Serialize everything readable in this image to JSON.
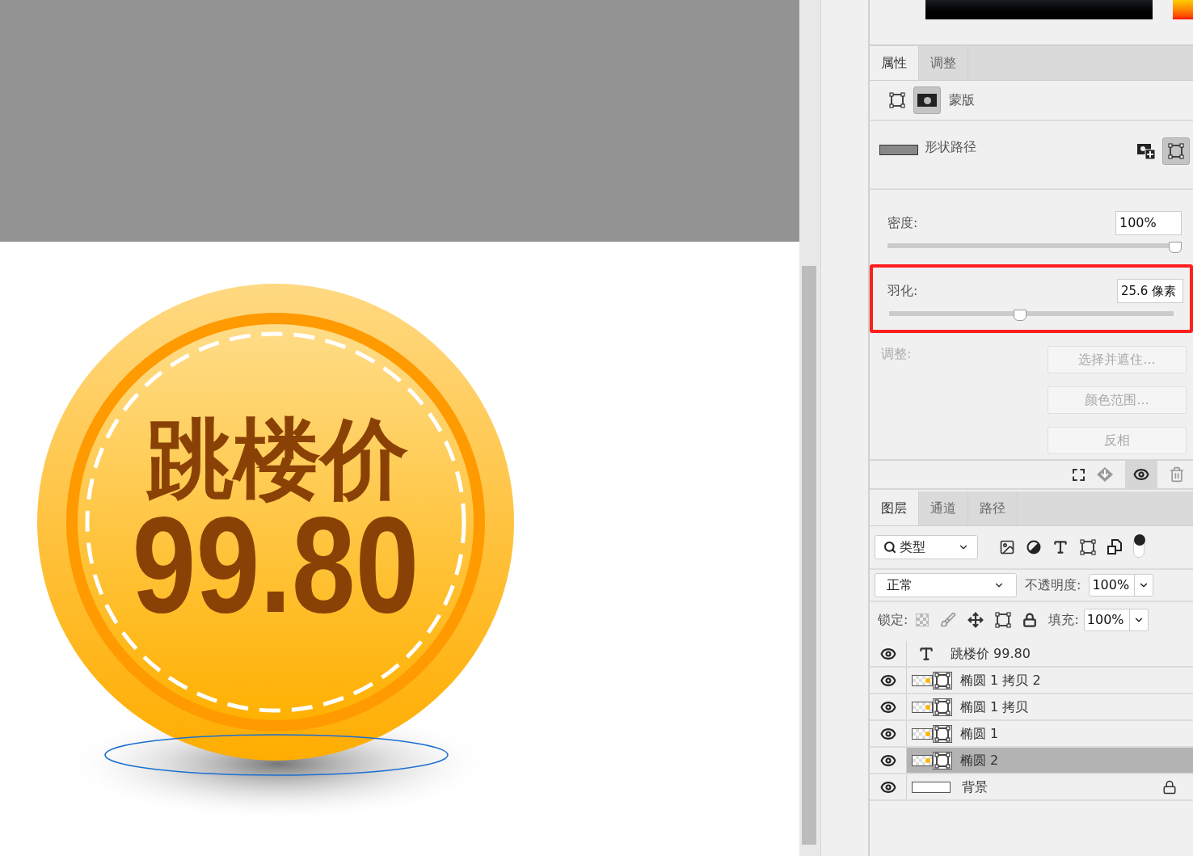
{
  "canvas": {
    "artwork": {
      "title": "跳楼价",
      "price": "99.80"
    }
  },
  "properties_panel": {
    "tabs": [
      {
        "label": "属性",
        "selected": true
      },
      {
        "label": "调整",
        "selected": false
      }
    ],
    "mask_label": "蒙版",
    "shape_path_label": "形状路径",
    "density": {
      "label": "密度:",
      "value": "100%",
      "level": 1
    },
    "feather": {
      "label": "羽化:",
      "value": "25.6 像素",
      "level": 0.46,
      "highlighted": true
    },
    "refine": {
      "label": "调整:",
      "buttons": [
        {
          "label": "选择并遮住...",
          "disabled": true
        },
        {
          "label": "颜色范围...",
          "disabled": true
        },
        {
          "label": "反相",
          "disabled": true
        }
      ]
    }
  },
  "layers_panel": {
    "tabs": [
      {
        "label": "图层",
        "selected": true
      },
      {
        "label": "通道",
        "selected": false
      },
      {
        "label": "路径",
        "selected": false
      }
    ],
    "filter": "类型",
    "blend_mode": "正常",
    "opacity": {
      "label": "不透明度:",
      "value": "100%"
    },
    "lock_label": "锁定:",
    "fill": {
      "label": "填充:",
      "value": "100%"
    },
    "layers": [
      {
        "name": "跳楼价 99.80",
        "kind": "text",
        "selected": false,
        "locked": false
      },
      {
        "name": "椭圆 1 拷贝 2",
        "kind": "shape",
        "selected": false,
        "locked": false
      },
      {
        "name": "椭圆 1 拷贝",
        "kind": "shape",
        "selected": false,
        "locked": false
      },
      {
        "name": "椭圆 1",
        "kind": "shape",
        "selected": false,
        "locked": false
      },
      {
        "name": "椭圆 2",
        "kind": "shape",
        "selected": true,
        "locked": false
      },
      {
        "name": "背景",
        "kind": "background",
        "selected": false,
        "locked": true
      }
    ]
  }
}
